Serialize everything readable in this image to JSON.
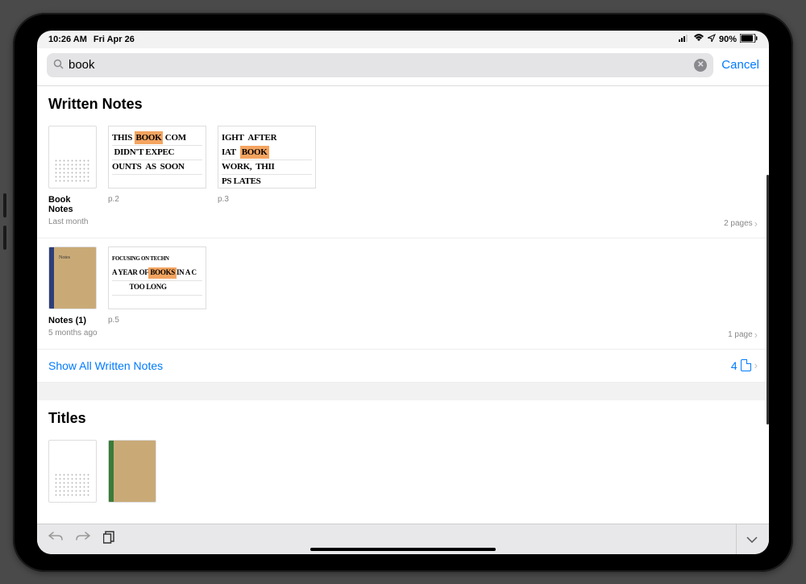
{
  "statusbar": {
    "time": "10:26 AM",
    "date": "Fri Apr 26",
    "battery": "90%"
  },
  "search": {
    "value": "book",
    "cancel": "Cancel"
  },
  "sections": {
    "written": "Written Notes",
    "titles": "Titles"
  },
  "results": [
    {
      "title": "Book Notes",
      "pages": [
        {
          "label": "p.2",
          "lines": [
            "THIS ~BOOK~ COMI",
            " DIDN'T EXPEC",
            "OUNTS AS SOON"
          ]
        },
        {
          "label": "p.3",
          "lines": [
            "IGHT AFTER",
            "IAT ~BOOK~",
            "WORK, THII",
            "PS LATES"
          ]
        }
      ],
      "ago": "Last month",
      "count": "2 pages"
    },
    {
      "title": "Notes (1)",
      "pages": [
        {
          "label": "p.5",
          "lines": [
            "FOCUSING ON TECHN",
            "A YEAR OF ~BOOKS~ IN A C",
            "TOO LONG"
          ]
        }
      ],
      "ago": "5 months ago",
      "count": "1 page"
    }
  ],
  "showAll": {
    "label": "Show All Written Notes",
    "count": "4"
  }
}
